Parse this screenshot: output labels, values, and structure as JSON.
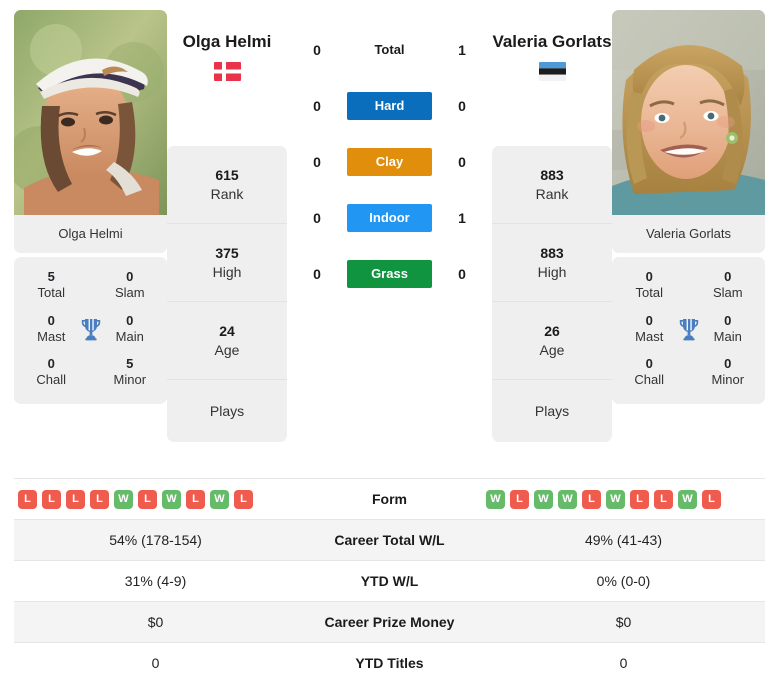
{
  "players": {
    "left": {
      "name": "Olga Helmi",
      "photo_caption": "Olga Helmi",
      "country": "Denmark",
      "flag_icon": "flag-denmark",
      "rank": "615",
      "rank_label": "Rank",
      "high": "375",
      "high_label": "High",
      "age": "24",
      "age_label": "Age",
      "plays": "Plays",
      "titles": {
        "total": "5",
        "total_label": "Total",
        "slam": "0",
        "slam_label": "Slam",
        "mast": "0",
        "mast_label": "Mast",
        "main": "0",
        "main_label": "Main",
        "chall": "0",
        "chall_label": "Chall",
        "minor": "5",
        "minor_label": "Minor"
      },
      "h2h": {
        "total": "0",
        "hard": "0",
        "clay": "0",
        "indoor": "0",
        "grass": "0"
      },
      "form": [
        "L",
        "L",
        "L",
        "L",
        "W",
        "L",
        "W",
        "L",
        "W",
        "L"
      ],
      "career_wl": "54% (178-154)",
      "ytd_wl": "31% (4-9)",
      "career_prize": "$0",
      "ytd_titles": "0"
    },
    "right": {
      "name": "Valeria Gorlats",
      "photo_caption": "Valeria Gorlats",
      "country": "Estonia",
      "flag_icon": "flag-estonia",
      "rank": "883",
      "rank_label": "Rank",
      "high": "883",
      "high_label": "High",
      "age": "26",
      "age_label": "Age",
      "plays": "Plays",
      "titles": {
        "total": "0",
        "total_label": "Total",
        "slam": "0",
        "slam_label": "Slam",
        "mast": "0",
        "mast_label": "Mast",
        "main": "0",
        "main_label": "Main",
        "chall": "0",
        "chall_label": "Chall",
        "minor": "0",
        "minor_label": "Minor"
      },
      "h2h": {
        "total": "1",
        "hard": "0",
        "clay": "0",
        "indoor": "1",
        "grass": "0"
      },
      "form": [
        "W",
        "L",
        "W",
        "W",
        "L",
        "W",
        "L",
        "L",
        "W",
        "L"
      ],
      "career_wl": "49% (41-43)",
      "ytd_wl": "0% (0-0)",
      "career_prize": "$0",
      "ytd_titles": "0"
    }
  },
  "surfaces": {
    "total_label": "Total",
    "hard_label": "Hard",
    "clay_label": "Clay",
    "indoor_label": "Indoor",
    "grass_label": "Grass",
    "colors": {
      "hard": "#0a6ebd",
      "clay": "#e08e0b",
      "indoor": "#2196f3",
      "grass": "#109440"
    }
  },
  "table": {
    "rows": [
      {
        "label": "Form",
        "key": "form"
      },
      {
        "label": "Career Total W/L",
        "key": "career_wl"
      },
      {
        "label": "YTD W/L",
        "key": "ytd_wl"
      },
      {
        "label": "Career Prize Money",
        "key": "career_prize"
      },
      {
        "label": "YTD Titles",
        "key": "ytd_titles"
      }
    ]
  },
  "icons": {
    "trophy": "trophy-icon"
  },
  "colors": {
    "win": "#66bb6a",
    "loss": "#ef5b4c",
    "card_bg": "#efefef",
    "alt_row": "#f4f4f4"
  }
}
